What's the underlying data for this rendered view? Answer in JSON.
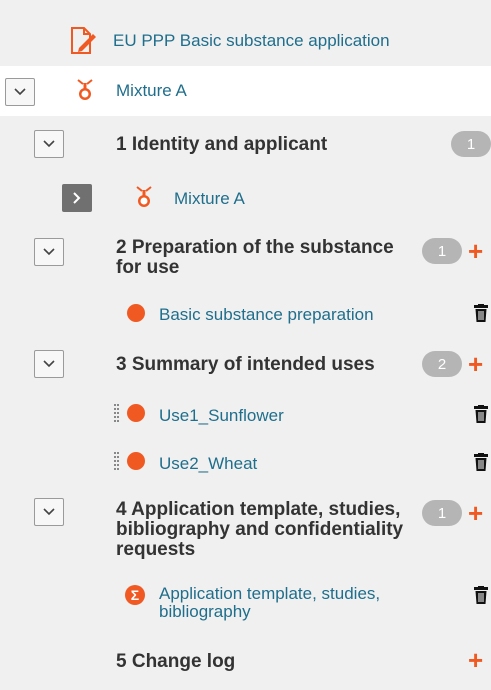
{
  "header": {
    "title": "EU PPP Basic substance application"
  },
  "root": {
    "label": "Mixture A"
  },
  "sections": [
    {
      "title": "1 Identity and applicant",
      "count": "1",
      "child": "Mixture A"
    },
    {
      "title_line1": "2 Preparation of the substance",
      "title_line2": "for use",
      "count": "1",
      "child": "Basic substance preparation"
    },
    {
      "title": "3 Summary of intended uses",
      "count": "2",
      "children": [
        "Use1_Sunflower",
        "Use2_Wheat"
      ]
    },
    {
      "title_line1": "4 Application template, studies,",
      "title_line2": "bibliography and confidentiality",
      "title_line3": "requests",
      "count": "1",
      "child_line1": "Application template, studies,",
      "child_line2": "bibliography"
    },
    {
      "title": "5 Change log"
    }
  ],
  "icons": {
    "accent": "#f05a22",
    "link_color": "#1f6e8c"
  }
}
